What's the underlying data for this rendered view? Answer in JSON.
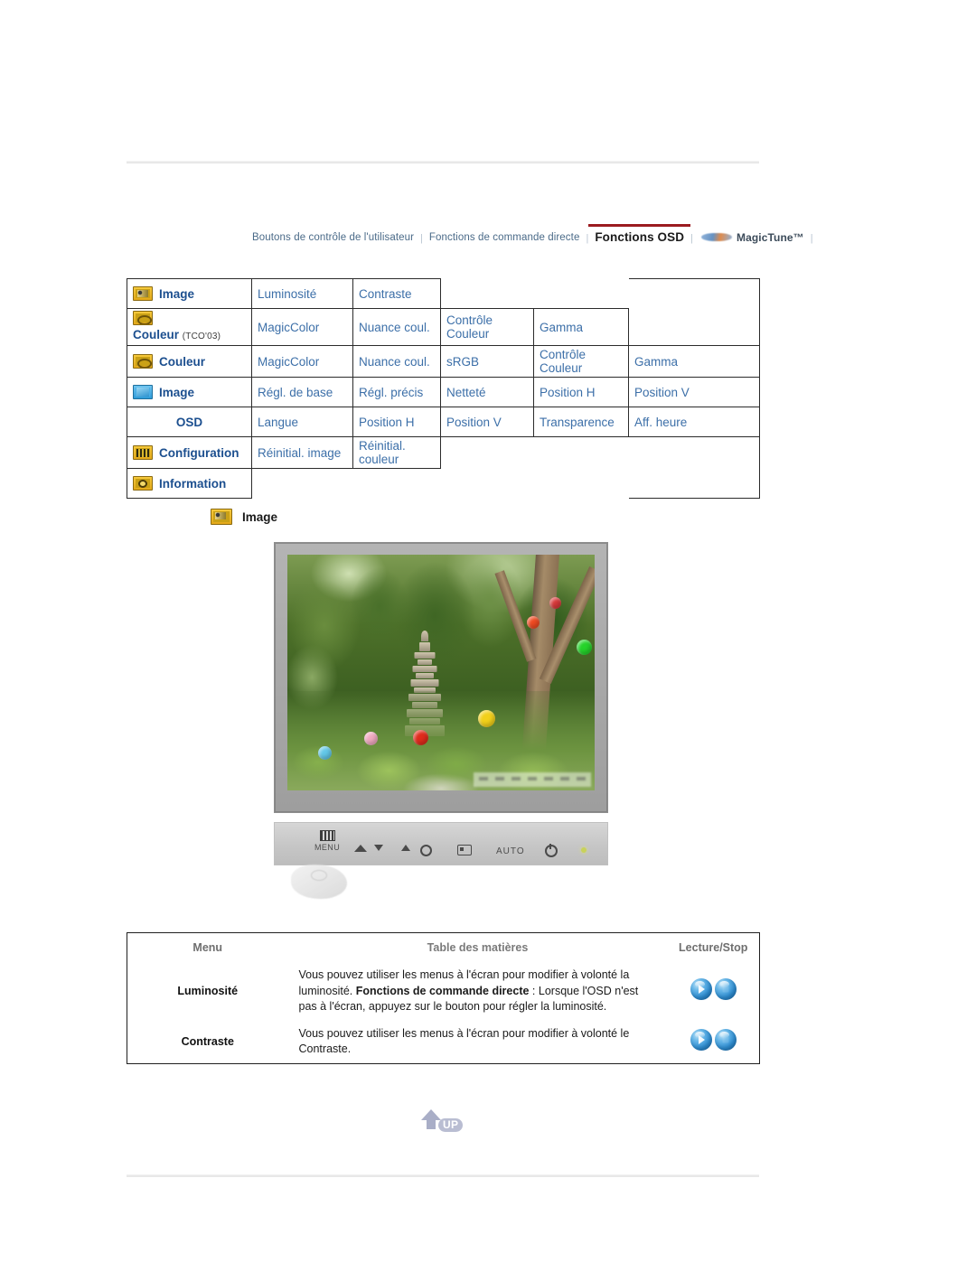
{
  "nav": {
    "items": [
      {
        "label": "Boutons de contrôle de l'utilisateur",
        "active": false
      },
      {
        "label": "Fonctions de commande directe",
        "active": false
      },
      {
        "label": "Fonctions OSD",
        "active": true
      },
      {
        "label": "MagicTune™",
        "active": false
      }
    ],
    "separator": "|"
  },
  "osd_matrix": {
    "rows": [
      {
        "icon": "image-icon",
        "lead": "Image",
        "note": "",
        "cells": [
          "Luminosité",
          "Contraste"
        ]
      },
      {
        "icon": "color-icon",
        "lead": "Couleur",
        "note": "(TCO'03)",
        "cells": [
          "MagicColor",
          "Nuance coul.",
          "Contrôle Couleur",
          "Gamma"
        ]
      },
      {
        "icon": "color-icon",
        "lead": "Couleur",
        "note": "",
        "cells": [
          "MagicColor",
          "Nuance coul.",
          "sRGB",
          "Contrôle Couleur",
          "Gamma"
        ]
      },
      {
        "icon": "image-blue-icon",
        "lead": "Image",
        "note": "",
        "cells": [
          "Régl. de base",
          "Régl. précis",
          "Netteté",
          "Position H",
          "Position V"
        ]
      },
      {
        "icon": "none",
        "lead": "OSD",
        "note": "",
        "cells": [
          "Langue",
          "Position H",
          "Position V",
          "Transparence",
          "Aff. heure"
        ]
      },
      {
        "icon": "config-icon",
        "lead": "Configuration",
        "note": "",
        "cells": [
          "Réinitial. image",
          "Réinitial. couleur"
        ]
      },
      {
        "icon": "info-icon",
        "lead": "Information",
        "note": "",
        "cells": []
      }
    ]
  },
  "section": {
    "icon": "image-icon",
    "title": "Image"
  },
  "monitor": {
    "buttons": [
      {
        "name": "menu-button",
        "label": "MENU"
      },
      {
        "name": "down-button",
        "label": ""
      },
      {
        "name": "up-button",
        "label": ""
      },
      {
        "name": "brightness-button",
        "label": ""
      },
      {
        "name": "source-button",
        "label": ""
      },
      {
        "name": "auto-button",
        "label": "AUTO"
      },
      {
        "name": "power-button",
        "label": ""
      },
      {
        "name": "power-led",
        "label": ""
      }
    ]
  },
  "desc_table": {
    "headers": [
      "Menu",
      "Table des matières",
      "Lecture/Stop"
    ],
    "rows": [
      {
        "menu": "Luminosité",
        "paragraphs": [
          {
            "bold": "",
            "text": "Vous pouvez utiliser les menus à l'écran pour modifier à volonté la luminosité."
          },
          {
            "bold": "Fonctions de commande directe",
            "text": " : Lorsque l'OSD n'est pas à l'écran, appuyez sur le bouton pour régler la luminosité."
          }
        ],
        "controls": [
          "play",
          "stop"
        ]
      },
      {
        "menu": "Contraste",
        "paragraphs": [
          {
            "bold": "",
            "text": "Vous pouvez utiliser les menus à l'écran pour modifier à volonté le Contraste."
          }
        ],
        "controls": [
          "play",
          "stop"
        ]
      }
    ]
  },
  "footer": {
    "up_label": "UP"
  },
  "colors": {
    "cell_text": "#3c6fa8",
    "lead_text": "#1c4f8f",
    "active_tab_underline": "#9b1b20",
    "icon_gold": "#e3a81a",
    "orb_blue": "#2f8fd4"
  }
}
